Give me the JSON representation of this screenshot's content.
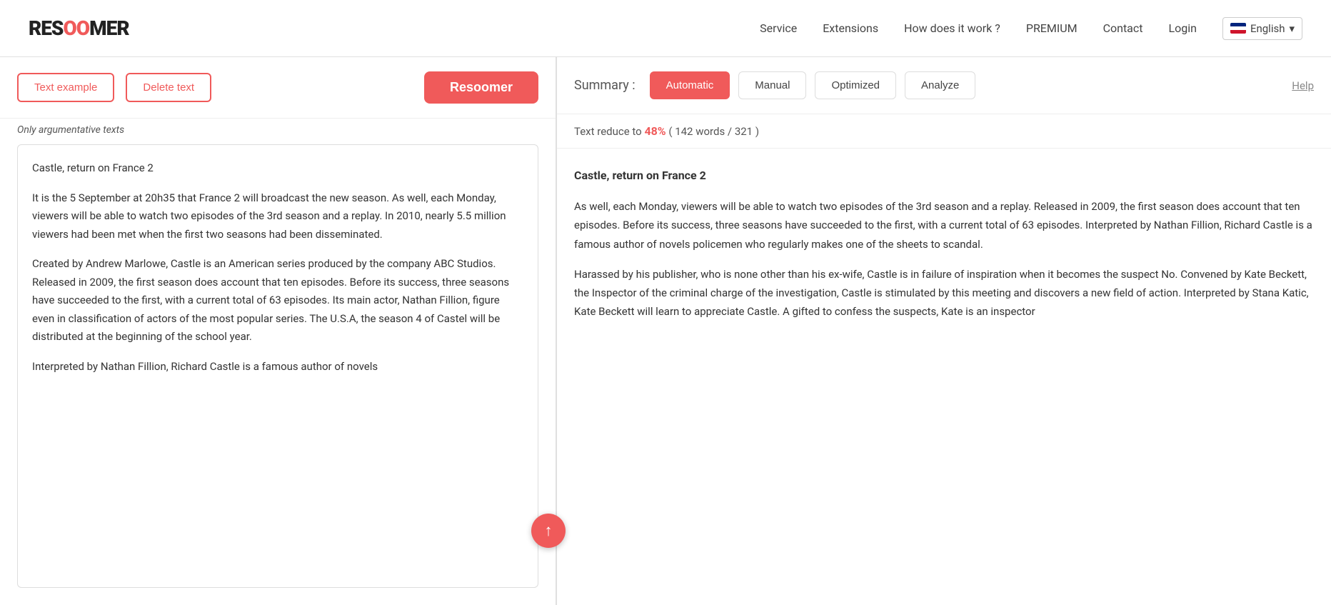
{
  "header": {
    "logo_text_1": "RES",
    "logo_oo": "OO",
    "logo_text_2": "MER",
    "nav": [
      {
        "label": "Service",
        "id": "nav-service"
      },
      {
        "label": "Extensions",
        "id": "nav-extensions"
      },
      {
        "label": "How does it work ?",
        "id": "nav-how"
      },
      {
        "label": "PREMIUM",
        "id": "nav-premium"
      },
      {
        "label": "Contact",
        "id": "nav-contact"
      },
      {
        "label": "Login",
        "id": "nav-login"
      }
    ],
    "lang_label": "English"
  },
  "left_panel": {
    "btn_text_example": "Text example",
    "btn_delete_text": "Delete text",
    "btn_resoomer": "Resoomer",
    "only_argumentative": "Only argumentative texts",
    "article_title": "Castle, return on France 2",
    "paragraphs": [
      "It is the 5 September at 20h35 that France 2 will broadcast the new season. As well, each Monday, viewers will be able to watch two episodes of the 3rd season and a replay. In 2010, nearly 5.5 million viewers had been met when the first two seasons had been disseminated.",
      "Created by Andrew Marlowe, Castle is an American series produced by the company ABC Studios. Released in 2009, the first season does account that ten episodes. Before its success, three seasons have succeeded to the first, with a current total of 63 episodes. Its main actor, Nathan Fillion, figure even in classification of actors of the most popular series. The U.S.A, the season 4 of Castel will be distributed at the beginning of the school year.",
      "Interpreted by Nathan Fillion, Richard Castle is a famous author of novels"
    ]
  },
  "right_panel": {
    "summary_label": "Summary :",
    "tabs": [
      {
        "label": "Automatic",
        "active": true
      },
      {
        "label": "Manual",
        "active": false
      },
      {
        "label": "Optimized",
        "active": false
      },
      {
        "label": "Analyze",
        "active": false
      }
    ],
    "help_label": "Help",
    "stats_text_before": "Text reduce to ",
    "stats_pct": "48%",
    "stats_text_after": " ( 142 words / 321 )",
    "summary_title": "Castle, return on France 2",
    "summary_paragraphs": [
      "As well, each Monday, viewers will be able to watch two episodes of the 3rd season and a replay. Released in 2009, the first season does account that ten episodes. Before its success, three seasons have succeeded to the first, with a current total of 63 episodes. Interpreted by Nathan Fillion, Richard Castle is a famous author of novels policemen who regularly makes one of the sheets to scandal.",
      "Harassed by his publisher, who is none other than his ex-wife, Castle is in failure of inspiration when it becomes the suspect No. Convened by Kate Beckett, the Inspector of the criminal charge of the investigation, Castle is stimulated by this meeting and discovers a new field of action. Interpreted by Stana Katic, Kate Beckett will learn to appreciate Castle. A gifted to confess the suspects, Kate is an inspector"
    ]
  }
}
